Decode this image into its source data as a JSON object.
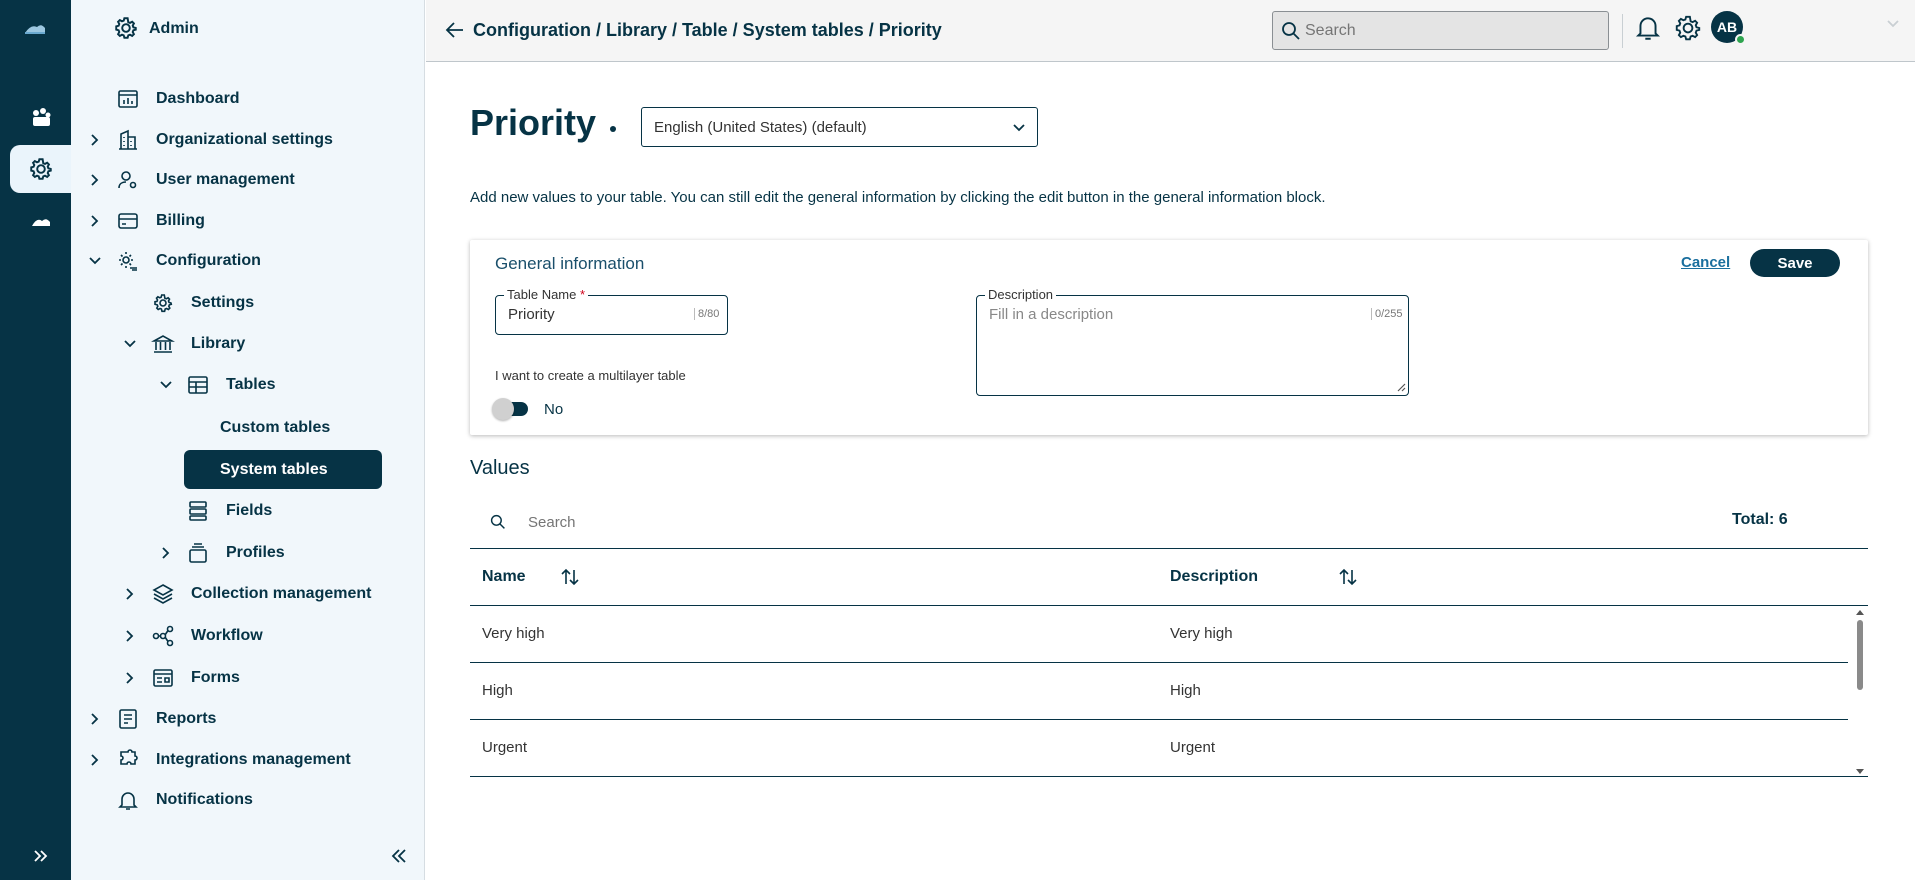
{
  "sidebar": {
    "admin_label": "Admin",
    "items": [
      {
        "label": "Dashboard",
        "icon": "dashboard-icon"
      },
      {
        "label": "Organizational settings",
        "icon": "building-icon"
      },
      {
        "label": "User management",
        "icon": "user-settings-icon"
      },
      {
        "label": "Billing",
        "icon": "credit-card-icon"
      },
      {
        "label": "Configuration",
        "icon": "configuration-icon"
      },
      {
        "label": "Settings",
        "icon": "gear-icon"
      },
      {
        "label": "Library",
        "icon": "library-icon"
      },
      {
        "label": "Tables",
        "icon": "table-icon"
      },
      {
        "label": "Custom tables"
      },
      {
        "label": "System tables"
      },
      {
        "label": "Fields",
        "icon": "fields-icon"
      },
      {
        "label": "Profiles",
        "icon": "stack-icon"
      },
      {
        "label": "Collection management",
        "icon": "layers-icon"
      },
      {
        "label": "Workflow",
        "icon": "workflow-icon"
      },
      {
        "label": "Forms",
        "icon": "forms-icon"
      },
      {
        "label": "Reports",
        "icon": "report-icon"
      },
      {
        "label": "Integrations management",
        "icon": "puzzle-icon"
      },
      {
        "label": "Notifications",
        "icon": "bell-icon"
      }
    ]
  },
  "header": {
    "breadcrumb": "Configuration / Library / Table / System tables / Priority",
    "search_placeholder": "Search",
    "avatar_initials": "AB"
  },
  "page": {
    "title": "Priority",
    "language": "English (United States) (default)",
    "intro": "Add new values to your table. You can still edit the general information by clicking the edit button in the general information block."
  },
  "general": {
    "heading": "General information",
    "cancel": "Cancel",
    "save": "Save",
    "table_name_label": "Table Name",
    "required_mark": "*",
    "table_name_value": "Priority",
    "table_name_counter": "8/80",
    "description_label": "Description",
    "description_placeholder": "Fill in a description",
    "description_counter": "0/255",
    "multilayer_label": "I want to create a multilayer table",
    "toggle_value": "No"
  },
  "values": {
    "heading": "Values",
    "search_placeholder": "Search",
    "total": "Total: 6",
    "columns": [
      "Name",
      "Description"
    ],
    "rows": [
      {
        "name": "Very high",
        "description": "Very high"
      },
      {
        "name": "High",
        "description": "High"
      },
      {
        "name": "Urgent",
        "description": "Urgent"
      }
    ]
  },
  "colors": {
    "primary": "#063345",
    "sidebar_bg": "#f1f7fb",
    "accent_link": "#1a6f9e",
    "success": "#2ea44f"
  }
}
